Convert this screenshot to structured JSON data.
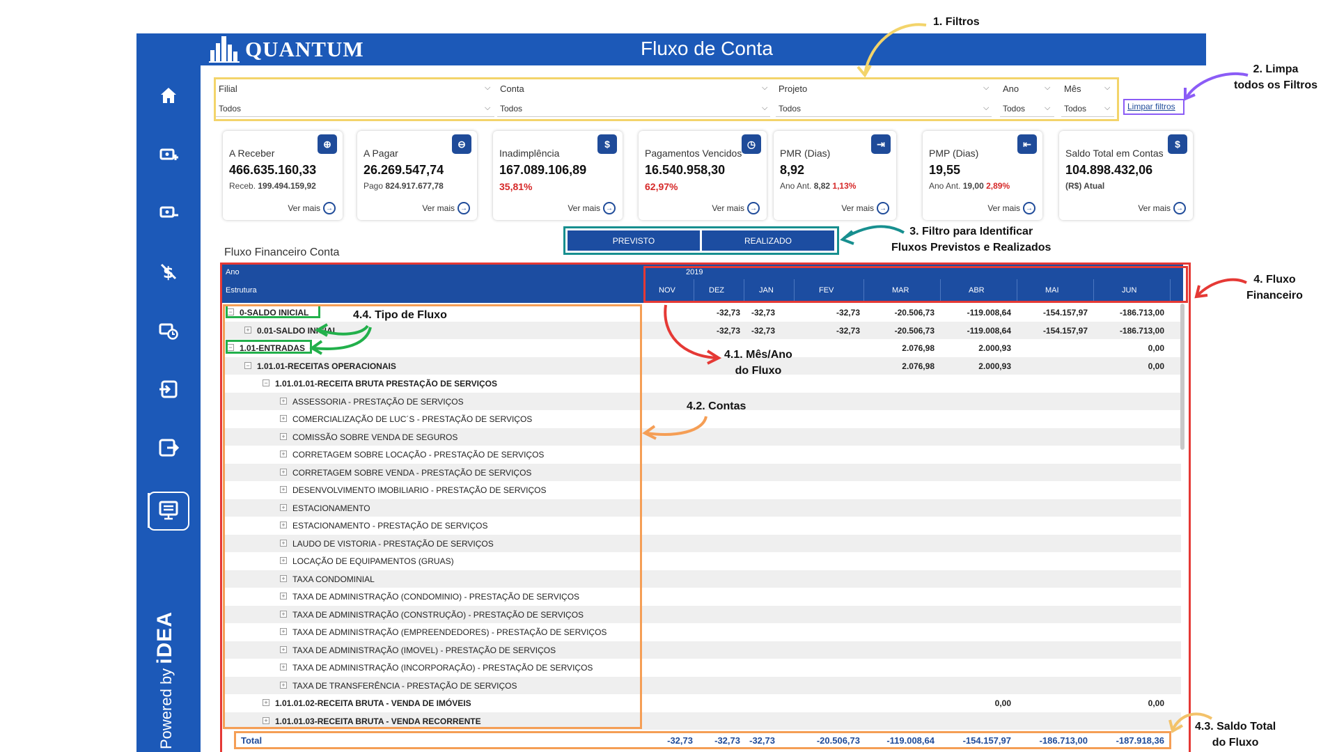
{
  "app": {
    "logo_text": "QUANTUM",
    "title": "Fluxo de Conta",
    "powered_prefix": "Powered by",
    "powered_brand": "iDEA"
  },
  "sidebar": {
    "items": [
      "home-icon",
      "receivable-icon",
      "payable-icon",
      "delinquency-icon",
      "overdue-icon",
      "pmr-icon",
      "pmp-icon",
      "cash-flow-icon"
    ]
  },
  "filters": {
    "filial": {
      "label": "Filial",
      "value": "Todos"
    },
    "conta": {
      "label": "Conta",
      "value": "Todos"
    },
    "projeto": {
      "label": "Projeto",
      "value": "Todos"
    },
    "ano": {
      "label": "Ano",
      "value": "Todos"
    },
    "mes": {
      "label": "Mês",
      "value": "Todos"
    },
    "clear_label": "Limpar filtros"
  },
  "cards": [
    {
      "title": "A Receber",
      "value": "466.635.160,33",
      "sub_prefix": "Receb.",
      "sub_value": "199.494.159,92",
      "sub_red": "",
      "more": "Ver mais"
    },
    {
      "title": "A Pagar",
      "value": "26.269.547,74",
      "sub_prefix": "Pago",
      "sub_value": "824.917.677,78",
      "sub_red": "",
      "more": "Ver mais"
    },
    {
      "title": "Inadimplência",
      "value": "167.089.106,89",
      "sub_prefix": "",
      "sub_value": "",
      "sub_red": "35,81%",
      "more": "Ver mais"
    },
    {
      "title": "Pagamentos Vencidos",
      "value": "16.540.958,30",
      "sub_prefix": "",
      "sub_value": "",
      "sub_red": "62,97%",
      "more": "Ver mais"
    },
    {
      "title": "PMR (Dias)",
      "value": "8,92",
      "sub_prefix": "Ano Ant.",
      "sub_value": "8,82",
      "sub_red": "1,13%",
      "more": "Ver mais"
    },
    {
      "title": "PMP (Dias)",
      "value": "19,55",
      "sub_prefix": "Ano Ant.",
      "sub_value": "19,00",
      "sub_red": "2,89%",
      "more": "Ver mais"
    },
    {
      "title": "Saldo Total em Contas",
      "value": "104.898.432,06",
      "sub_prefix": "",
      "sub_value": "(R$) Atual",
      "sub_red": "",
      "more": "Ver mais"
    }
  ],
  "toggle": {
    "left": "PREVISTO",
    "right": "REALIZADO"
  },
  "table": {
    "section_title": "Fluxo Financeiro Conta",
    "header_year_label": "Ano",
    "header_structure_label": "Estrutura",
    "year": "2019",
    "months": [
      "NOV",
      "DEZ",
      "JAN",
      "FEV",
      "MAR",
      "ABR",
      "MAI",
      "JUN"
    ],
    "rows": [
      {
        "label": "0-SALDO INICIAL",
        "level": 0,
        "bold": true,
        "sign": "−",
        "values": [
          "",
          "-32,73",
          "-32,73",
          "-32,73",
          "-20.506,73",
          "-119.008,64",
          "-154.157,97",
          "-186.713,00"
        ]
      },
      {
        "label": "0.01-SALDO INICIAL",
        "level": 1,
        "bold": true,
        "sign": "+",
        "values": [
          "",
          "-32,73",
          "-32,73",
          "-32,73",
          "-20.506,73",
          "-119.008,64",
          "-154.157,97",
          "-186.713,00"
        ]
      },
      {
        "label": "1.01-ENTRADAS",
        "level": 0,
        "bold": true,
        "sign": "−",
        "values": [
          "",
          "",
          "",
          "",
          "2.076,98",
          "2.000,93",
          "",
          "0,00"
        ]
      },
      {
        "label": "1.01.01-RECEITAS OPERACIONAIS",
        "level": 1,
        "bold": true,
        "sign": "−",
        "values": [
          "",
          "",
          "",
          "",
          "2.076,98",
          "2.000,93",
          "",
          "0,00"
        ]
      },
      {
        "label": "1.01.01.01-RECEITA BRUTA PRESTAÇÃO DE SERVIÇOS",
        "level": 2,
        "bold": true,
        "sign": "−",
        "values": [
          "",
          "",
          "",
          "",
          "",
          "",
          "",
          ""
        ]
      },
      {
        "label": "ASSESSORIA - PRESTAÇÃO DE SERVIÇOS",
        "level": 3,
        "bold": false,
        "sign": "+",
        "values": [
          "",
          "",
          "",
          "",
          "",
          "",
          "",
          ""
        ]
      },
      {
        "label": "COMERCIALIZAÇÃO DE LUC´S - PRESTAÇÃO DE SERVIÇOS",
        "level": 3,
        "bold": false,
        "sign": "+",
        "values": [
          "",
          "",
          "",
          "",
          "",
          "",
          "",
          ""
        ]
      },
      {
        "label": "COMISSÃO SOBRE VENDA DE SEGUROS",
        "level": 3,
        "bold": false,
        "sign": "+",
        "values": [
          "",
          "",
          "",
          "",
          "",
          "",
          "",
          ""
        ]
      },
      {
        "label": "CORRETAGEM SOBRE LOCAÇÃO - PRESTAÇÃO DE SERVIÇOS",
        "level": 3,
        "bold": false,
        "sign": "+",
        "values": [
          "",
          "",
          "",
          "",
          "",
          "",
          "",
          ""
        ]
      },
      {
        "label": "CORRETAGEM SOBRE VENDA - PRESTAÇÃO DE SERVIÇOS",
        "level": 3,
        "bold": false,
        "sign": "+",
        "values": [
          "",
          "",
          "",
          "",
          "",
          "",
          "",
          ""
        ]
      },
      {
        "label": "DESENVOLVIMENTO IMOBILIARIO - PRESTAÇÃO DE SERVIÇOS",
        "level": 3,
        "bold": false,
        "sign": "+",
        "values": [
          "",
          "",
          "",
          "",
          "",
          "",
          "",
          ""
        ]
      },
      {
        "label": "ESTACIONAMENTO",
        "level": 3,
        "bold": false,
        "sign": "+",
        "values": [
          "",
          "",
          "",
          "",
          "",
          "",
          "",
          ""
        ]
      },
      {
        "label": "ESTACIONAMENTO - PRESTAÇÃO DE SERVIÇOS",
        "level": 3,
        "bold": false,
        "sign": "+",
        "values": [
          "",
          "",
          "",
          "",
          "",
          "",
          "",
          ""
        ]
      },
      {
        "label": "LAUDO DE VISTORIA - PRESTAÇÃO DE SERVIÇOS",
        "level": 3,
        "bold": false,
        "sign": "+",
        "values": [
          "",
          "",
          "",
          "",
          "",
          "",
          "",
          ""
        ]
      },
      {
        "label": "LOCAÇÃO DE EQUIPAMENTOS (GRUAS)",
        "level": 3,
        "bold": false,
        "sign": "+",
        "values": [
          "",
          "",
          "",
          "",
          "",
          "",
          "",
          ""
        ]
      },
      {
        "label": "TAXA CONDOMINIAL",
        "level": 3,
        "bold": false,
        "sign": "+",
        "values": [
          "",
          "",
          "",
          "",
          "",
          "",
          "",
          ""
        ]
      },
      {
        "label": "TAXA DE ADMINISTRAÇÃO (CONDOMINIO) - PRESTAÇÃO DE SERVIÇOS",
        "level": 3,
        "bold": false,
        "sign": "+",
        "values": [
          "",
          "",
          "",
          "",
          "",
          "",
          "",
          ""
        ]
      },
      {
        "label": "TAXA DE ADMINISTRAÇÃO (CONSTRUÇÃO) - PRESTAÇÃO DE SERVIÇOS",
        "level": 3,
        "bold": false,
        "sign": "+",
        "values": [
          "",
          "",
          "",
          "",
          "",
          "",
          "",
          ""
        ]
      },
      {
        "label": "TAXA DE ADMINISTRAÇÃO (EMPREENDEDORES) - PRESTAÇÃO DE SERVIÇOS",
        "level": 3,
        "bold": false,
        "sign": "+",
        "values": [
          "",
          "",
          "",
          "",
          "",
          "",
          "",
          ""
        ]
      },
      {
        "label": "TAXA DE ADMINISTRAÇÃO (IMOVEL) - PRESTAÇÃO DE SERVIÇOS",
        "level": 3,
        "bold": false,
        "sign": "+",
        "values": [
          "",
          "",
          "",
          "",
          "",
          "",
          "",
          ""
        ]
      },
      {
        "label": "TAXA DE ADMINISTRAÇÃO (INCORPORAÇÃO) - PRESTAÇÃO DE SERVIÇOS",
        "level": 3,
        "bold": false,
        "sign": "+",
        "values": [
          "",
          "",
          "",
          "",
          "",
          "",
          "",
          ""
        ]
      },
      {
        "label": "TAXA DE TRANSFERÊNCIA - PRESTAÇÃO DE SERVIÇOS",
        "level": 3,
        "bold": false,
        "sign": "+",
        "values": [
          "",
          "",
          "",
          "",
          "",
          "",
          "",
          ""
        ]
      },
      {
        "label": "1.01.01.02-RECEITA BRUTA - VENDA DE IMÓVEIS",
        "level": 2,
        "bold": true,
        "sign": "+",
        "values": [
          "",
          "",
          "",
          "",
          "",
          "0,00",
          "",
          "0,00"
        ]
      },
      {
        "label": "1.01.01.03-RECEITA BRUTA - VENDA RECORRENTE",
        "level": 2,
        "bold": true,
        "sign": "+",
        "values": [
          "",
          "",
          "",
          "",
          "",
          "",
          "",
          ""
        ]
      }
    ],
    "total_label": "Total",
    "total_values": [
      "-32,73",
      "-32,73",
      "-32,73",
      "-20.506,73",
      "-119.008,64",
      "-154.157,97",
      "-186.713,00",
      "-187.918,36"
    ]
  },
  "annotations": {
    "filters": "1. Filtros",
    "clear_line1": "2. Limpa",
    "clear_line2": "todos os Filtros",
    "toggle_line1": "3. Filtro para Identificar",
    "toggle_line2": "Fluxos Previstos e Realizados",
    "flow_line1": "4. Fluxo",
    "flow_line2": "Financeiro",
    "month_line1": "4.1. Mês/Ano",
    "month_line2": "do Fluxo",
    "accounts": "4.2. Contas",
    "total_line1": "4.3. Saldo Total",
    "total_line2": "do Fluxo",
    "flow_type": "4.4. Tipo de Fluxo",
    "colors": {
      "yellow": "#f3d46a",
      "purple": "#8b5cf6",
      "teal": "#178f8f",
      "red": "#e53935",
      "orange": "#f59e55",
      "green": "#22b04b"
    }
  }
}
